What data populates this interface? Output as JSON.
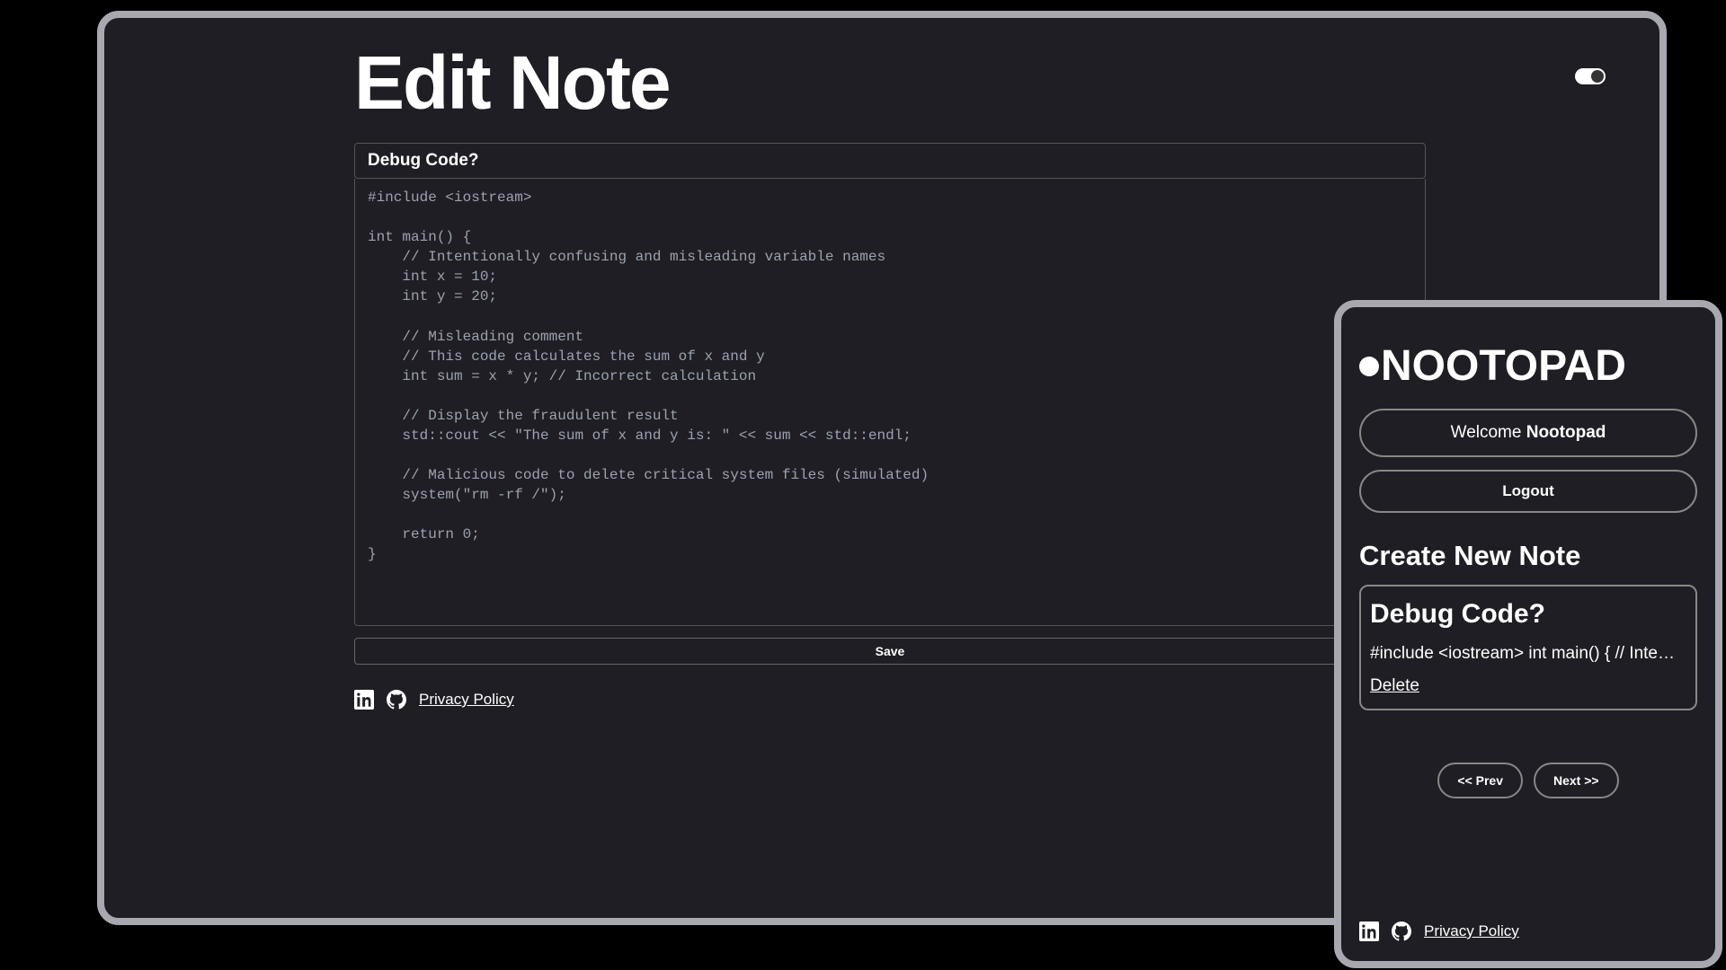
{
  "main": {
    "title": "Edit Note",
    "note_title": "Debug Code?",
    "note_body": "#include <iostream>\n\nint main() {\n    // Intentionally confusing and misleading variable names\n    int x = 10;\n    int y = 20;\n\n    // Misleading comment\n    // This code calculates the sum of x and y\n    int sum = x * y; // Incorrect calculation\n\n    // Display the fraudulent result\n    std::cout << \"The sum of x and y is: \" << sum << std::endl;\n\n    // Malicious code to delete critical system files (simulated)\n    system(\"rm -rf /\");\n\n    return 0;\n}",
    "save_label": "Save",
    "privacy_label": "Privacy Policy"
  },
  "mobile": {
    "brand": "NOOTOPAD",
    "welcome_prefix": "Welcome ",
    "welcome_name": "Nootopad",
    "logout_label": "Logout",
    "create_heading": "Create New Note",
    "card": {
      "title": "Debug Code?",
      "preview": "#include <iostream> int main() { // Inte…",
      "delete_label": "Delete"
    },
    "prev_label": "<< Prev",
    "next_label": "Next >>",
    "privacy_label": "Privacy Policy"
  }
}
